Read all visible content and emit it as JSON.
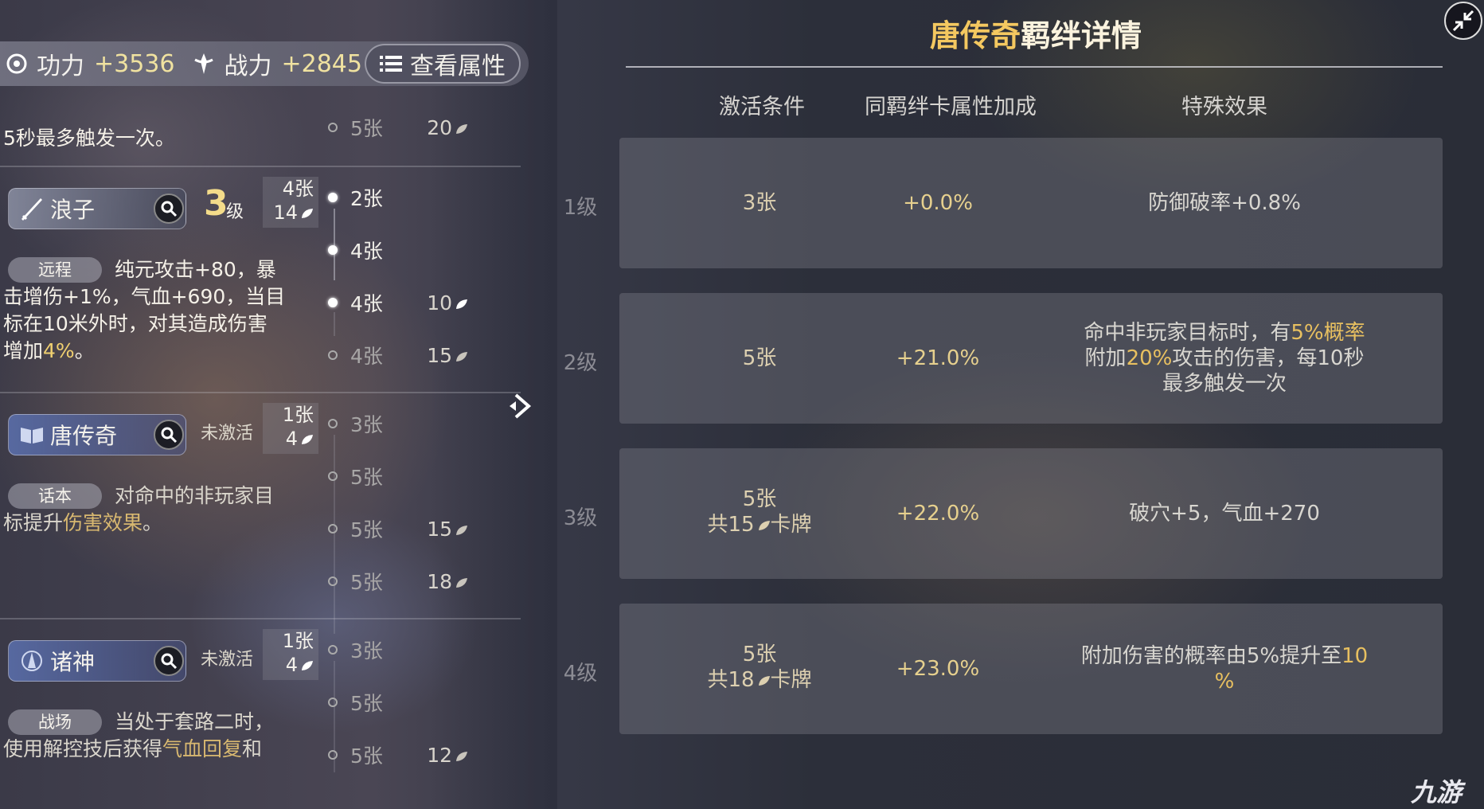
{
  "stats": {
    "power_label": "功力",
    "power_value": "+3536",
    "combat_label": "战力",
    "combat_value": "+2845",
    "attr_button": "查看属性"
  },
  "top_desc": {
    "line2": "5秒最多触发一次。"
  },
  "top_tier": {
    "count": "5张",
    "pts": "20"
  },
  "bonds": [
    {
      "name": "浪子",
      "level_num": "3",
      "level_unit": "级",
      "count_cards": "4张",
      "count_pts": "14",
      "tag": "远程",
      "desc_a": "纯元攻击+80，暴",
      "desc_b": "击增伤+1%，气血+690，当目",
      "desc_c": "标在10米外时，对其造成伤害",
      "desc_d_pre": "增加",
      "desc_d_hl": "4%",
      "desc_d_post": "。",
      "tiers": [
        {
          "count": "2张",
          "pts": ""
        },
        {
          "count": "4张",
          "pts": ""
        },
        {
          "count": "4张",
          "pts": "10"
        },
        {
          "count": "4张",
          "pts": "15"
        }
      ]
    },
    {
      "name": "唐传奇",
      "status": "未激活",
      "count_cards": "1张",
      "count_pts": "4",
      "tag": "话本",
      "desc_a": "对命中的非玩家目",
      "desc_b_pre": "标提升",
      "desc_b_hl": "伤害效果",
      "desc_b_post": "。",
      "tiers": [
        {
          "count": "3张",
          "pts": ""
        },
        {
          "count": "5张",
          "pts": ""
        },
        {
          "count": "5张",
          "pts": "15"
        },
        {
          "count": "5张",
          "pts": "18"
        }
      ]
    },
    {
      "name": "诸神",
      "status": "未激活",
      "count_cards": "1张",
      "count_pts": "4",
      "tag": "战场",
      "desc_a": "当处于套路二时，",
      "desc_b_pre": "使用解控技后获得",
      "desc_b_hl": "气血回复",
      "desc_b_post": "和",
      "tiers": [
        {
          "count": "3张",
          "pts": ""
        },
        {
          "count": "5张",
          "pts": ""
        },
        {
          "count": "5张",
          "pts": "12"
        }
      ]
    }
  ],
  "panel": {
    "title_name": "唐传奇",
    "title_rest": "羁绊详情",
    "col_condition": "激活条件",
    "col_bonus": "同羁绊卡属性加成",
    "col_effect": "特殊效果",
    "rows": [
      {
        "level": "1级",
        "cond1": "3张",
        "cond2": "",
        "bonus": "+0.0%",
        "effect1": "防御破率+0.8%",
        "effect2": "",
        "effect3": ""
      },
      {
        "level": "2级",
        "cond1": "5张",
        "cond2": "",
        "bonus": "+21.0%",
        "effect1_pre": "命中非玩家目标时，有",
        "effect1_hl": "5%概率",
        "effect2_pre": "附加",
        "effect2_hl": "20%",
        "effect2_post": "攻击的伤害，每10秒",
        "effect3": "最多触发一次"
      },
      {
        "level": "3级",
        "cond1": "5张",
        "cond2_pre": "共15",
        "cond2_post": "卡牌",
        "bonus": "+22.0%",
        "effect1": "破穴+5，气血+270"
      },
      {
        "level": "4级",
        "cond1": "5张",
        "cond2_pre": "共18",
        "cond2_post": "卡牌",
        "bonus": "+23.0%",
        "effect1_pre": "附加伤害的概率由5%提升至",
        "effect1_hl": "10",
        "effect2_hl": "%"
      }
    ]
  },
  "watermark": "九游",
  "colors": {
    "accent_gold": "#f4c860",
    "highlight": "#f0d070",
    "panel_row": "#96969f"
  }
}
